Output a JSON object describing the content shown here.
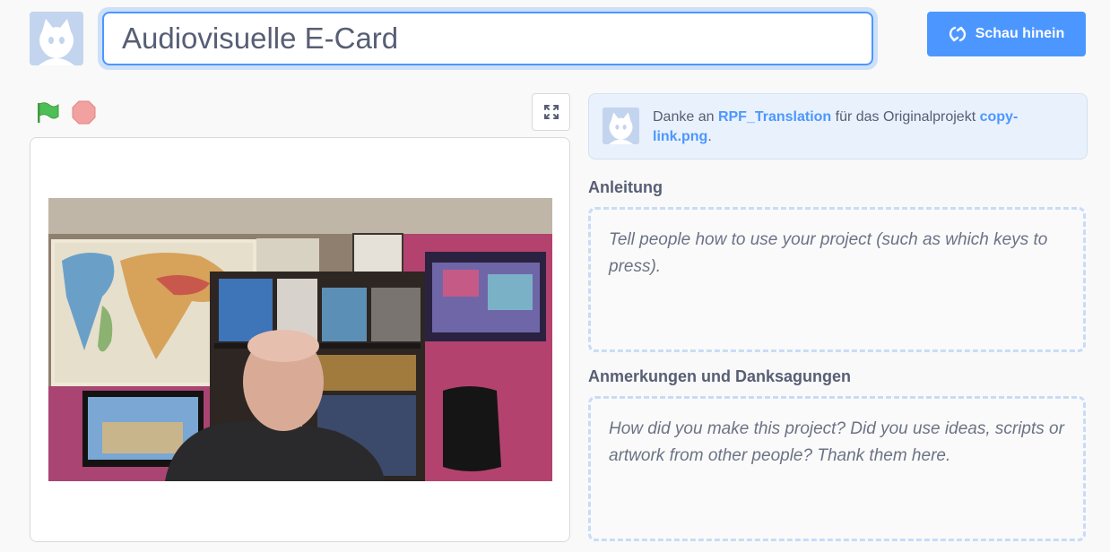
{
  "header": {
    "project_title": "Audiovisuelle E-Card",
    "see_inside_label": "Schau hinein",
    "see_inside_icon": "remix-icon"
  },
  "player": {
    "green_flag_icon": "green-flag-icon",
    "stop_icon": "stop-sign-icon",
    "fullscreen_icon": "fullscreen-icon"
  },
  "credit": {
    "prefix": "Danke an ",
    "user": "RPF_Translation",
    "middle": " für das Originalprojekt ",
    "project": "copy-link.png",
    "suffix": "."
  },
  "instructions": {
    "label": "Anleitung",
    "placeholder": "Tell people how to use your project (such as which keys to press)."
  },
  "notes": {
    "label": "Anmerkungen und Danksagungen",
    "placeholder": "How did you make this project? Did you use ideas, scripts or artwork from other people? Thank them here."
  },
  "colors": {
    "accent": "#4c97ff",
    "text": "#575e75",
    "green_flag": "#4cbf56",
    "stop": "#ec5959"
  }
}
